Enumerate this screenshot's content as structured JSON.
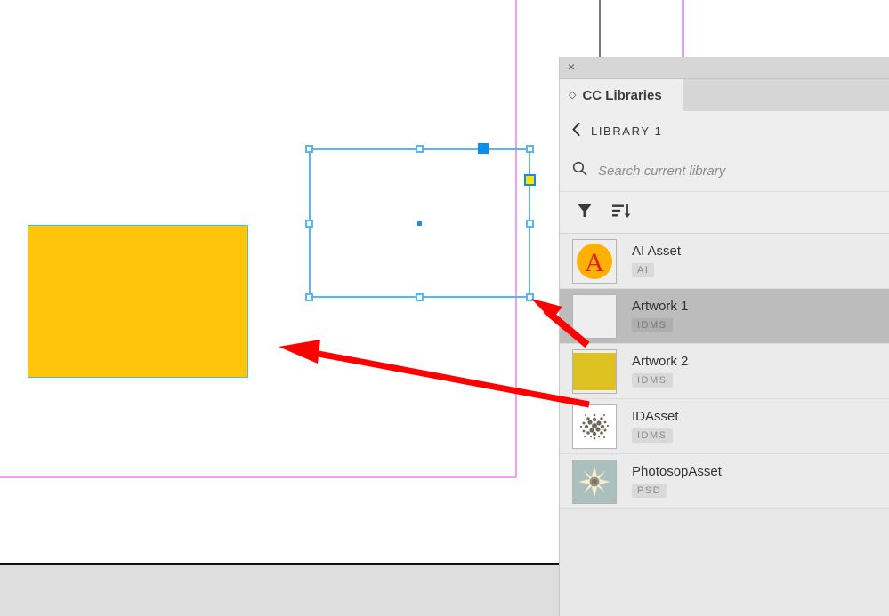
{
  "canvas": {
    "artwork_rect": {
      "name": "yellow-artwork-rectangle",
      "fill": "#ffc40c",
      "stroke": "#3ec5d8"
    },
    "guides_color": "#ef9ef3",
    "selection": {
      "stroke": "#55b7f5",
      "reference_point_color": "#ffe200",
      "active_handle_color": "#0b8ef0"
    },
    "annotation_arrow_color": "#ff0000"
  },
  "panel": {
    "close_label": "×",
    "tab": {
      "diamond": "◇",
      "label": "CC Libraries"
    },
    "breadcrumb": {
      "back": "‹",
      "label": "LIBRARY 1"
    },
    "search": {
      "value": "",
      "placeholder": "Search current library"
    },
    "toolbar": {
      "filter_label": "filter-icon",
      "sort_label": "sort-icon"
    },
    "assets": [
      {
        "title": "AI Asset",
        "ext": "AI",
        "thumb": "ai-logo",
        "selected": false
      },
      {
        "title": "Artwork 1",
        "ext": "IDMS",
        "thumb": "blank",
        "selected": true
      },
      {
        "title": "Artwork 2",
        "ext": "IDMS",
        "thumb": "yellow-swatch",
        "selected": false
      },
      {
        "title": "IDAsset",
        "ext": "IDMS",
        "thumb": "scatter-cloud",
        "selected": false
      },
      {
        "title": "PhotosopAsset",
        "ext": "PSD",
        "thumb": "starburst",
        "selected": false
      }
    ]
  }
}
